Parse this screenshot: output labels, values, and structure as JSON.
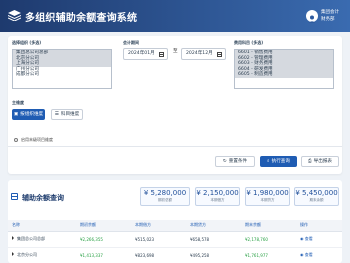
{
  "header": {
    "title": "多组织辅助余额查询系统",
    "user_line1": "集团会计",
    "user_line2": "财务部"
  },
  "filters": {
    "org_label": "选择组织 (多选)",
    "orgs": [
      "集团总公司总部",
      "北京分公司",
      "上海分公司",
      "广州分公司",
      "成都分公司"
    ],
    "period_label": "会计期间",
    "period_start": "2024年01月",
    "period_to": "至",
    "period_end": "2024年12月",
    "account_label": "费用科目 (多选)",
    "accounts": [
      "6601 - 销售费用",
      "6602 - 管理费用",
      "6603 - 财务费用",
      "6604 - 研发费用",
      "6605 - 制造费用"
    ]
  },
  "dimension": {
    "label": "主维度",
    "by_org": "按组织维度",
    "by_account": "科目维度"
  },
  "option": {
    "label": "启用末级项目维度"
  },
  "actions": {
    "reset": "重置条件",
    "query": "执行查询",
    "export": "导出报表"
  },
  "results": {
    "title": "辅助余额查询",
    "stats": [
      {
        "value": "¥ 5,280,000",
        "label": "期初总额"
      },
      {
        "value": "¥ 2,150,000",
        "label": "本期借方"
      },
      {
        "value": "¥ 1,980,000",
        "label": "本期贷方"
      },
      {
        "value": "¥ 5,450,000",
        "label": "期末余额"
      }
    ],
    "columns": [
      "名称",
      "期初余额",
      "本期借方",
      "本期贷方",
      "期末余额",
      "操作"
    ],
    "rows": [
      {
        "name": "集团总公司总部",
        "opening": "¥2,266,355",
        "debit": "¥515,023",
        "credit": "¥658,578",
        "closing": "¥2,178,760",
        "op": "查看"
      },
      {
        "name": "北京分公司",
        "opening": "¥1,413,337",
        "debit": "¥823,698",
        "credit": "¥495,258",
        "closing": "¥1,761,977",
        "op": "查看"
      }
    ]
  },
  "colors": {
    "primary": "#1f5cb3",
    "header_start": "#1e3a6e",
    "header_end": "#3a6bb0",
    "positive": "#27a043"
  }
}
